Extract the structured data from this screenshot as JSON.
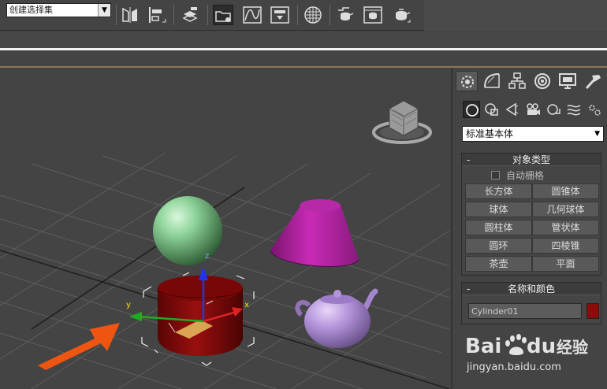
{
  "toolbar": {
    "selection_set": "创建选择集",
    "icons": [
      "mirror-icon",
      "align-icon",
      "layer-manager-icon",
      "scene-explorer-icon",
      "curve-editor-icon",
      "schematic-view-icon",
      "material-editor-icon",
      "render-setup-icon",
      "rendered-frame-icon",
      "render-production-icon"
    ]
  },
  "command_panel": {
    "tabs": [
      "create-icon",
      "modify-icon",
      "hierarchy-icon",
      "motion-icon",
      "display-icon",
      "utilities-icon"
    ],
    "categories": [
      "geometry-icon",
      "shapes-icon",
      "lights-icon",
      "cameras-icon",
      "helpers-icon",
      "space-warps-icon",
      "systems-icon"
    ],
    "category_select": "标准基本体",
    "object_type": {
      "title": "对象类型",
      "toggle": "-",
      "autogrid_label": "自动栅格",
      "buttons": [
        "长方体",
        "圆锥体",
        "球体",
        "几何球体",
        "圆柱体",
        "管状体",
        "圆环",
        "四棱锥",
        "茶壶",
        "平面"
      ]
    },
    "name_color": {
      "title": "名称和颜色",
      "toggle": "-",
      "name": "Cylinder01",
      "color": "#8c0b0b"
    }
  },
  "viewport": {
    "gizmo_labels": {
      "x": "x",
      "y": "y",
      "z": "z"
    },
    "colors": {
      "sphere": "#7fc48a",
      "cone": "#b0219e",
      "cylinder": "#8a0909",
      "teapot": "#b594dc",
      "arrow": "#ee5511"
    }
  },
  "watermark": {
    "brand_a": "Bai",
    "brand_b": "du",
    "brand_c": "经验",
    "url": "jingyan.baidu.com"
  }
}
